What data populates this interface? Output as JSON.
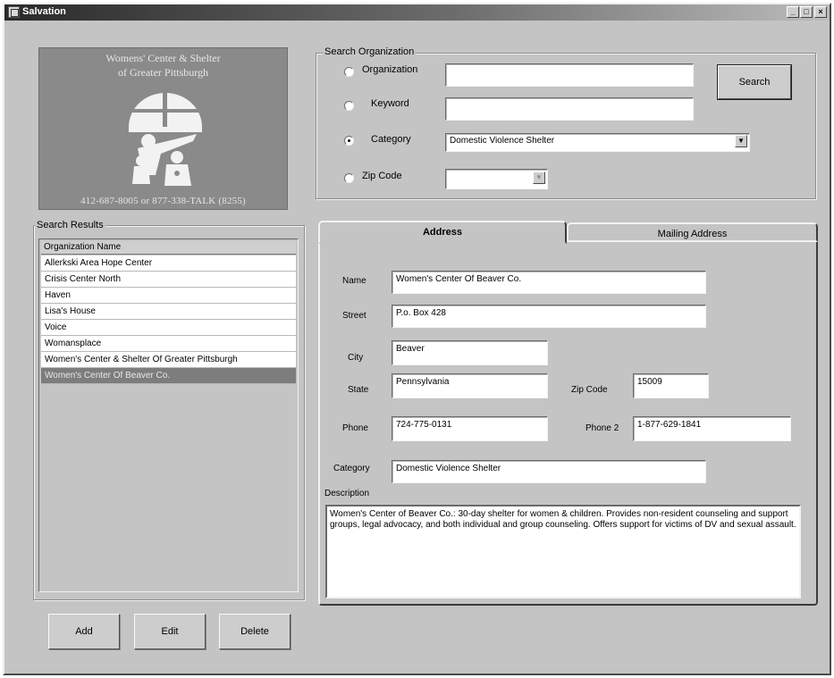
{
  "window": {
    "title": "Salvation"
  },
  "logo": {
    "line1": "Womens' Center & Shelter",
    "line2": "of Greater Pittsburgh",
    "phone": "412-687-8005 or 877-338-TALK (8255)"
  },
  "search": {
    "group_label": "Search Organization",
    "options": [
      {
        "label": "Organization",
        "selected": false
      },
      {
        "label": "Keyword",
        "selected": false
      },
      {
        "label": "Category",
        "selected": true
      },
      {
        "label": "Zip Code",
        "selected": false
      }
    ],
    "organization_value": "",
    "keyword_value": "",
    "category_value": "Domestic Violence Shelter",
    "zip_value": "",
    "search_button": "Search"
  },
  "results": {
    "group_label": "Search Results",
    "column_header": "Organization Name",
    "rows": [
      "Allerkski Area Hope Center",
      "Crisis Center North",
      "Haven",
      "Lisa's House",
      "Voice",
      "Womansplace",
      "Women's Center & Shelter Of Greater Pittsburgh",
      "Women's Center Of Beaver Co."
    ],
    "selected_index": 7
  },
  "tabs": {
    "address": "Address",
    "mailing": "Mailing Address"
  },
  "detail": {
    "name_label": "Name",
    "name_value": "Women's Center Of Beaver Co.",
    "street_label": "Street",
    "street_value": "P.o. Box 428",
    "city_label": "City",
    "city_value": "Beaver",
    "state_label": "State",
    "state_value": "Pennsylvania",
    "zip_label": "Zip Code",
    "zip_value": "15009",
    "phone_label": "Phone",
    "phone_value": "724-775-0131",
    "phone2_label": "Phone 2",
    "phone2_value": "1-877-629-1841",
    "category_label": "Category",
    "category_value": "Domestic Violence Shelter",
    "description_label": "Description",
    "description_value": "Women's Center of Beaver Co.:  30-day shelter for women & children.  Provides non-resident counseling and support groups, legal advocacy, and both individual and group counseling. Offers support for victims of DV and sexual assault."
  },
  "actions": {
    "add": "Add",
    "edit": "Edit",
    "delete": "Delete"
  }
}
